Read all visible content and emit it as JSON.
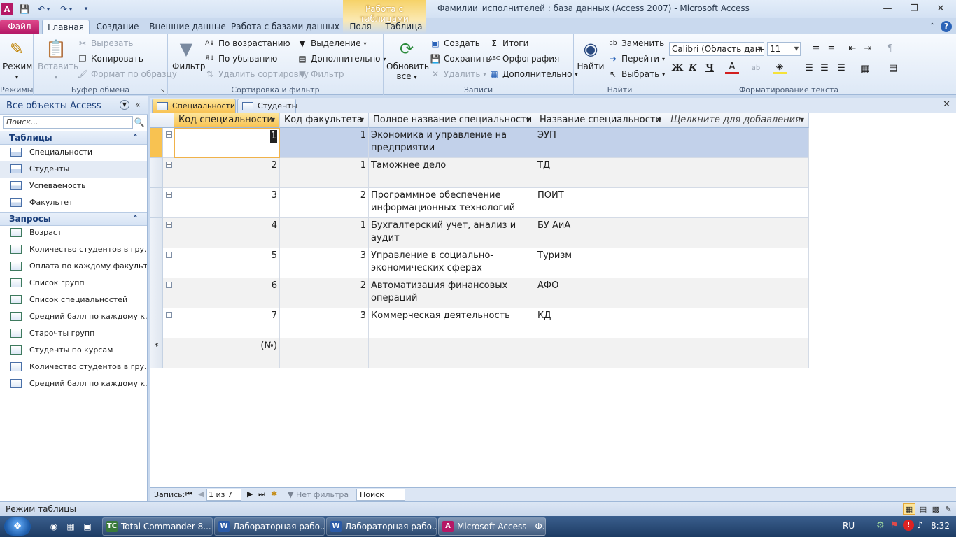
{
  "window": {
    "title": "Фамилии_исполнителей : база данных (Access 2007)  -  Microsoft Access",
    "context_tab_group": "Работа с таблицами"
  },
  "ribbon_tabs": [
    "Файл",
    "Главная",
    "Создание",
    "Внешние данные",
    "Работа с базами данных",
    "Поля",
    "Таблица"
  ],
  "ribbon": {
    "views": {
      "label": "Режимы",
      "mode": "Режим"
    },
    "clipboard": {
      "label": "Буфер обмена",
      "paste": "Вставить",
      "cut": "Вырезать",
      "copy": "Копировать",
      "format_painter": "Формат по образцу"
    },
    "sort_filter": {
      "label": "Сортировка и фильтр",
      "filter": "Фильтр",
      "ascending": "По возрастанию",
      "descending": "По убыванию",
      "remove_sort": "Удалить сортировку",
      "selection": "Выделение",
      "advanced": "Дополнительно",
      "toggle_filter": "Фильтр"
    },
    "records": {
      "label": "Записи",
      "refresh": "Обновить все",
      "new": "Создать",
      "save": "Сохранить",
      "delete": "Удалить",
      "totals": "Итоги",
      "spelling": "Орфография",
      "more": "Дополнительно"
    },
    "find": {
      "label": "Найти",
      "find": "Найти",
      "replace": "Заменить",
      "goto": "Перейти",
      "select": "Выбрать"
    },
    "text_format": {
      "label": "Форматирование текста",
      "font": "Calibri (Область данны",
      "size": "11",
      "bold": "Ж",
      "italic": "К",
      "underline": "Ч"
    }
  },
  "nav_pane": {
    "title": "Все объекты Access",
    "search_placeholder": "Поиск...",
    "tables_label": "Таблицы",
    "tables": [
      "Специальности",
      "Студенты",
      "Успеваемость",
      "Факультет"
    ],
    "queries_label": "Запросы",
    "queries": [
      "Возраст",
      "Количество студентов в гру...",
      "Оплата по каждому факульт...",
      "Список групп",
      "Список специальностей",
      "Средний балл по каждому к...",
      "Старочты групп",
      "Студенты по курсам",
      "Количество студентов в гру...",
      "Средний балл по каждому к..."
    ]
  },
  "doc_tabs": [
    "Специальности",
    "Студенты"
  ],
  "table": {
    "columns": [
      "Код специальности",
      "Код факультета",
      "Полное название специальности",
      "Название специальности",
      "Щелкните для добавления"
    ],
    "rows": [
      {
        "code": "1",
        "faculty": "1",
        "full": "Экономика и управление на предприятии",
        "short": "ЭУП"
      },
      {
        "code": "2",
        "faculty": "1",
        "full": "Таможнее дело",
        "short": "ТД"
      },
      {
        "code": "3",
        "faculty": "2",
        "full": "Программное обеспечение информационных технологий",
        "short": "ПОИТ"
      },
      {
        "code": "4",
        "faculty": "1",
        "full": "Бухгалтерский учет, анализ и аудит",
        "short": "БУ АиА"
      },
      {
        "code": "5",
        "faculty": "3",
        "full": "Управление в социально-экономических сферах",
        "short": "Туризм"
      },
      {
        "code": "6",
        "faculty": "2",
        "full": "Автоматизация финансовых операций",
        "short": "АФО"
      },
      {
        "code": "7",
        "faculty": "3",
        "full": "Коммерческая деятельность",
        "short": "КД"
      }
    ],
    "new_row_placeholder": "(№)"
  },
  "record_nav": {
    "label": "Запись:",
    "position": "1 из 7",
    "filter": "Нет фильтра",
    "search": "Поиск"
  },
  "status": {
    "text": "Режим таблицы"
  },
  "taskbar": {
    "tasks": [
      "Total Commander 8....",
      "Лабораторная рабо...",
      "Лабораторная рабо...",
      "Microsoft Access - Ф..."
    ],
    "lang": "RU",
    "time": "8:32"
  },
  "colors": {
    "accent": "#f8c251",
    "file_tab": "#b51966",
    "ribbon_bg": "#dde8f6",
    "selection": "#c2d1ea"
  }
}
